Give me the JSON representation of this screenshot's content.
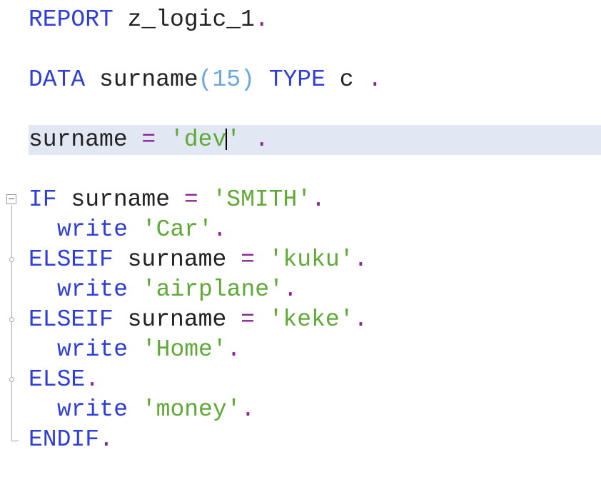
{
  "editor": {
    "lines": [
      {
        "tokens": [
          "REPORT",
          " z_logic_1",
          "."
        ]
      },
      {
        "tokens": [
          "DATA",
          " surname",
          "(",
          "15",
          ")",
          " TYPE",
          " c",
          " ."
        ]
      },
      {
        "tokens": [
          "surname",
          " =",
          " 'dev",
          "'",
          " ."
        ]
      },
      {
        "tokens": [
          "IF",
          " surname",
          " =",
          " 'SMITH'",
          "."
        ]
      },
      {
        "tokens": [
          "write",
          " 'Car'",
          "."
        ]
      },
      {
        "tokens": [
          "ELSEIF",
          " surname",
          " =",
          " 'kuku'",
          "."
        ]
      },
      {
        "tokens": [
          "write",
          " 'airplane'",
          "."
        ]
      },
      {
        "tokens": [
          "ELSEIF",
          " surname",
          " =",
          " 'keke'",
          "."
        ]
      },
      {
        "tokens": [
          "write",
          " 'Home'",
          "."
        ]
      },
      {
        "tokens": [
          "ELSE",
          "."
        ]
      },
      {
        "tokens": [
          "write",
          " 'money'",
          "."
        ]
      },
      {
        "tokens": [
          "ENDIF",
          "."
        ]
      }
    ]
  },
  "colors": {
    "keyword": "#2f3ed7",
    "string": "#5fa936",
    "number": "#6aa6e0",
    "operator": "#8a2597",
    "current_line_highlight": "#e2e8f3"
  },
  "icons": {
    "fold": "collapse-minus-icon"
  }
}
